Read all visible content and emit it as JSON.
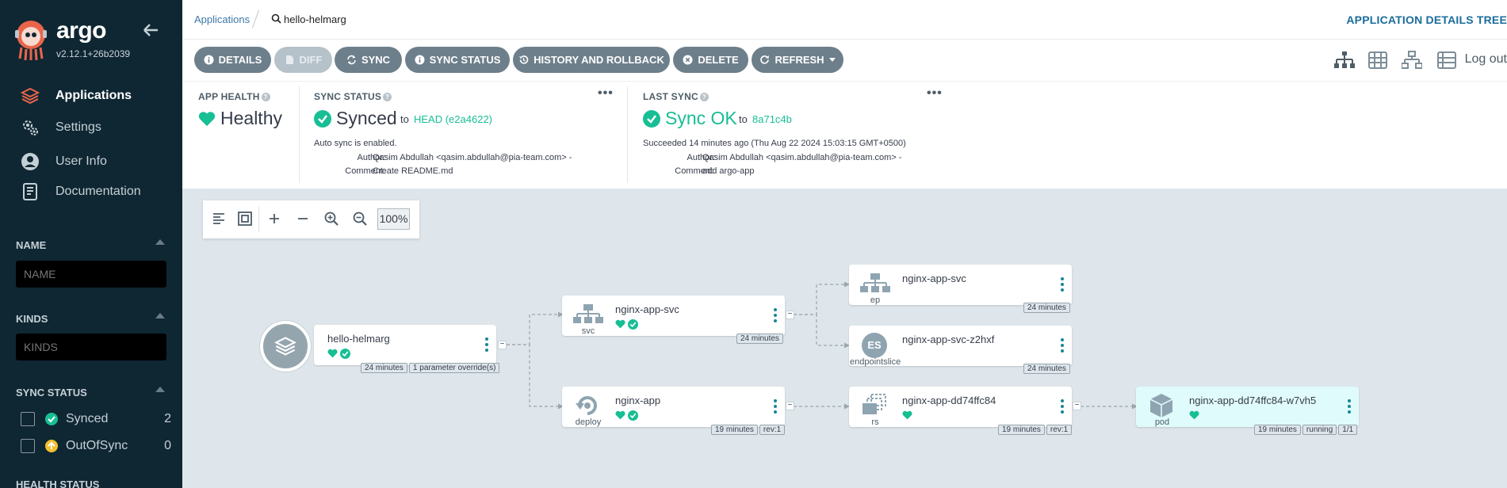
{
  "sidebar": {
    "brand": "argo",
    "version": "v2.12.1+26b2039",
    "nav": [
      {
        "label": "Applications",
        "icon": "layers-icon",
        "active": true
      },
      {
        "label": "Settings",
        "icon": "gears-icon",
        "active": false
      },
      {
        "label": "User Info",
        "icon": "user-icon",
        "active": false
      },
      {
        "label": "Documentation",
        "icon": "book-icon",
        "active": false
      }
    ],
    "filters": {
      "name_title": "NAME",
      "name_placeholder": "NAME",
      "kinds_title": "KINDS",
      "kinds_placeholder": "KINDS",
      "sync_title": "SYNC STATUS",
      "sync_items": [
        {
          "label": "Synced",
          "count": "2",
          "color": "#18be94"
        },
        {
          "label": "OutOfSync",
          "count": "0",
          "color": "#f4c030"
        }
      ],
      "health_title": "HEALTH STATUS"
    }
  },
  "topbar": {
    "breadcrumb_root": "Applications",
    "breadcrumb_current": "hello-helmarg",
    "title": "APPLICATION DETAILS TREE"
  },
  "toolbar": {
    "details": "DETAILS",
    "diff": "DIFF",
    "sync": "SYNC",
    "sync_status": "SYNC STATUS",
    "history": "HISTORY AND ROLLBACK",
    "delete": "DELETE",
    "refresh": "REFRESH",
    "logout": "Log out"
  },
  "status": {
    "health": {
      "title": "APP HEALTH",
      "value": "Healthy"
    },
    "sync": {
      "title": "SYNC STATUS",
      "value": "Synced",
      "to": "to",
      "revision": "HEAD (e2a4622)",
      "auto": "Auto sync is enabled.",
      "author_label": "Author:",
      "author": "Qasim Abdullah <qasim.abdullah@pia-team.com> -",
      "comment_label": "Comment:",
      "comment": "Create README.md",
      "menu": "•••"
    },
    "last_sync": {
      "title": "LAST SYNC",
      "value": "Sync OK",
      "to": "to",
      "revision": "8a71c4b",
      "succeeded": "Succeeded 14 minutes ago (Thu Aug 22 2024 15:03:15 GMT+0500)",
      "author_label": "Author:",
      "author": "Qasim Abdullah <qasim.abdullah@pia-team.com> -",
      "comment_label": "Comment:",
      "comment": "add argo-app",
      "menu": "•••"
    }
  },
  "graph": {
    "zoom": "100%",
    "app": {
      "name": "hello-helmarg",
      "tags": [
        "24 minutes",
        "1 parameter override(s)"
      ]
    },
    "svc": {
      "name": "nginx-app-svc",
      "kind": "svc",
      "tags": [
        "24 minutes"
      ]
    },
    "deploy": {
      "name": "nginx-app",
      "kind": "deploy",
      "tags": [
        "19 minutes",
        "rev:1"
      ]
    },
    "ep": {
      "name": "nginx-app-svc",
      "kind": "ep",
      "tags": [
        "24 minutes"
      ]
    },
    "eps": {
      "name": "nginx-app-svc-z2hxf",
      "kind": "endpointslice",
      "icon_text": "ES",
      "tags": [
        "24 minutes"
      ]
    },
    "rs": {
      "name": "nginx-app-dd74ffc84",
      "kind": "rs",
      "tags": [
        "19 minutes",
        "rev:1"
      ]
    },
    "pod": {
      "name": "nginx-app-dd74ffc84-w7vh5",
      "kind": "pod",
      "tags": [
        "19 minutes",
        "running",
        "1/1"
      ]
    },
    "collapse_glyph": "−"
  }
}
